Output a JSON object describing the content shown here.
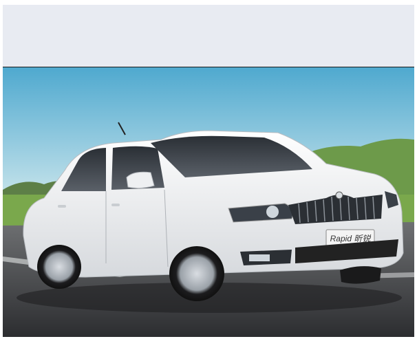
{
  "image": {
    "subject": "white-sedan-on-road",
    "license_plate_text": "Rapid 昕锐",
    "colors": {
      "header_band": "#e8ebf2",
      "sky_top": "#4fa9cf",
      "sky_bottom": "#cfe6ee",
      "car_body": "#f2f4f6",
      "road": "#3c3d40",
      "grass": "#7aa84c"
    }
  }
}
